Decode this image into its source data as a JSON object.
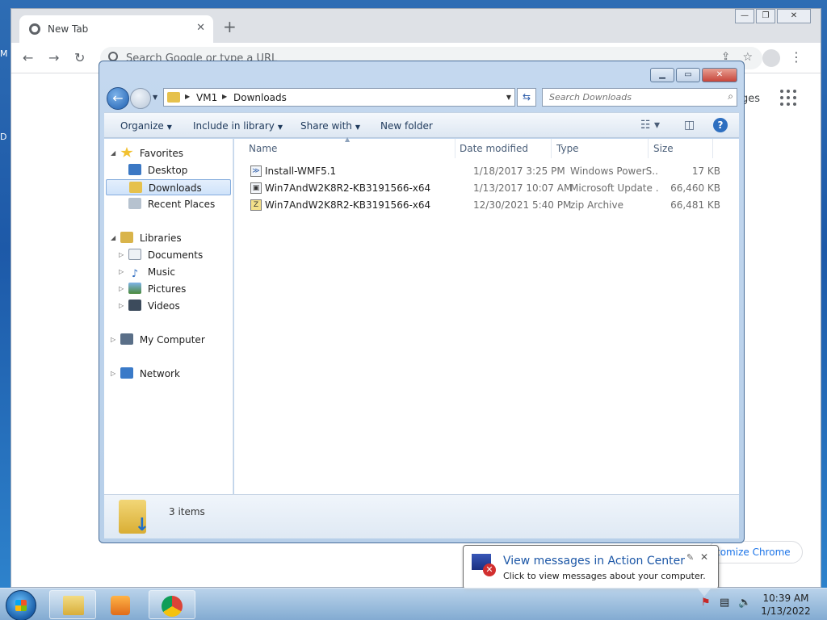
{
  "desktop": {
    "edge_letters": [
      "M",
      "D"
    ]
  },
  "chrome": {
    "tab_title": "New Tab",
    "omnibox_placeholder": "Search Google or type a URL",
    "images_link": "ges",
    "customize_label": "tomize Chrome"
  },
  "explorer": {
    "address": {
      "crumbs": [
        "VM1",
        "Downloads"
      ]
    },
    "search_placeholder": "Search Downloads",
    "commands": {
      "organize": "Organize",
      "include": "Include in library",
      "share": "Share with",
      "new_folder": "New folder"
    },
    "nav": {
      "favorites": "Favorites",
      "desktop": "Desktop",
      "downloads": "Downloads",
      "recent": "Recent Places",
      "libraries": "Libraries",
      "documents": "Documents",
      "music": "Music",
      "pictures": "Pictures",
      "videos": "Videos",
      "computer": "My Computer",
      "network": "Network"
    },
    "columns": {
      "name": "Name",
      "date": "Date modified",
      "type": "Type",
      "size": "Size"
    },
    "files": [
      {
        "name": "Install-WMF5.1",
        "date": "1/18/2017 3:25 PM",
        "type": "Windows PowerS...",
        "size": "17 KB"
      },
      {
        "name": "Win7AndW2K8R2-KB3191566-x64",
        "date": "1/13/2017 10:07 AM",
        "type": "Microsoft Update ...",
        "size": "66,460 KB"
      },
      {
        "name": "Win7AndW2K8R2-KB3191566-x64",
        "date": "12/30/2021 5:40 PM",
        "type": "zip Archive",
        "size": "66,481 KB"
      }
    ],
    "item_count": "3 items"
  },
  "balloon": {
    "title": "View messages in Action Center",
    "body": "Click to view messages about your computer."
  },
  "taskbar": {
    "time": "10:39 AM",
    "date": "1/13/2022"
  },
  "colors": {
    "accent": "#1b56a6",
    "selection": "#cfe3fa",
    "alert": "#d22f2f"
  }
}
